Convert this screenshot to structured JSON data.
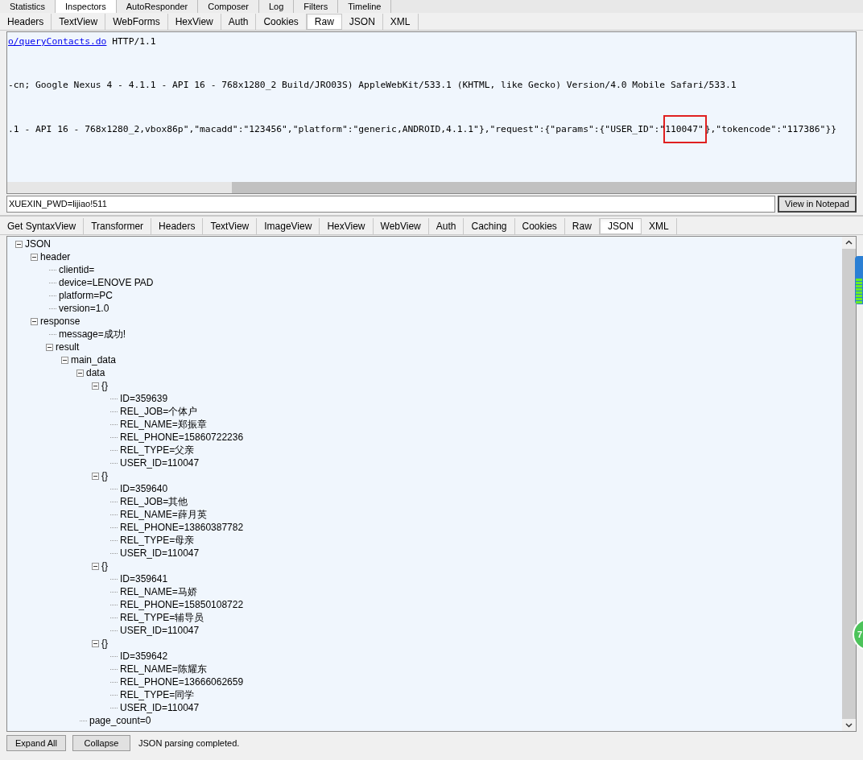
{
  "main_tabs": [
    {
      "label": "Statistics",
      "selected": false
    },
    {
      "label": "Inspectors",
      "selected": true
    },
    {
      "label": "AutoResponder",
      "selected": false
    },
    {
      "label": "Composer",
      "selected": false
    },
    {
      "label": "Log",
      "selected": false
    },
    {
      "label": "Filters",
      "selected": false
    },
    {
      "label": "Timeline",
      "selected": false
    }
  ],
  "request_tabs": [
    {
      "label": "Headers",
      "selected": false
    },
    {
      "label": "TextView",
      "selected": false
    },
    {
      "label": "WebForms",
      "selected": false
    },
    {
      "label": "HexView",
      "selected": false
    },
    {
      "label": "Auth",
      "selected": false
    },
    {
      "label": "Cookies",
      "selected": false
    },
    {
      "label": "Raw",
      "selected": true
    },
    {
      "label": "JSON",
      "selected": false
    },
    {
      "label": "XML",
      "selected": false
    }
  ],
  "raw_lines": [
    [
      {
        "kind": "link",
        "text": "o/queryContacts.do"
      },
      {
        "kind": "plain",
        "text": " HTTP/1.1"
      }
    ],
    [
      {
        "kind": "plain",
        "text": "-cn; Google Nexus 4 - 4.1.1 - API 16 - 768x1280_2 Build/JRO03S) AppleWebKit/533.1 (KHTML, like Gecko) Version/4.0 Mobile Safari/533.1"
      }
    ],
    [
      {
        "kind": "plain",
        "text": ".1 - API 16 - 768x1280_2,vbox86p\",\"macadd\":\"123456\",\"platform\":\"generic,ANDROID,4.1.1\"},\"request\":{\"params\":{\"USER_ID\":\""
      },
      {
        "kind": "boxed",
        "text": "110047\""
      },
      {
        "kind": "plain",
        "text": "},\"tokencode\":\"117386\"}}"
      }
    ]
  ],
  "cookie_field": {
    "value": "XUEXIN_PWD=lijiao!511"
  },
  "notepad_button": "View in Notepad",
  "response_tabs": [
    {
      "label": "Get SyntaxView",
      "selected": false
    },
    {
      "label": "Transformer",
      "selected": false
    },
    {
      "label": "Headers",
      "selected": false
    },
    {
      "label": "TextView",
      "selected": false
    },
    {
      "label": "ImageView",
      "selected": false
    },
    {
      "label": "HexView",
      "selected": false
    },
    {
      "label": "WebView",
      "selected": false
    },
    {
      "label": "Auth",
      "selected": false
    },
    {
      "label": "Caching",
      "selected": false
    },
    {
      "label": "Cookies",
      "selected": false
    },
    {
      "label": "Raw",
      "selected": false
    },
    {
      "label": "JSON",
      "selected": true
    },
    {
      "label": "XML",
      "selected": false
    }
  ],
  "tree": [
    {
      "label": "JSON",
      "expanded": true,
      "children": [
        {
          "label": "header",
          "expanded": true,
          "children": [
            {
              "label": "clientid="
            },
            {
              "label": "device=LENOVE PAD"
            },
            {
              "label": "platform=PC"
            },
            {
              "label": "version=1.0"
            }
          ]
        },
        {
          "label": "response",
          "expanded": true,
          "children": [
            {
              "label": "message=成功!"
            },
            {
              "label": "result",
              "expanded": true,
              "children": [
                {
                  "label": "main_data",
                  "expanded": true,
                  "children": [
                    {
                      "label": "data",
                      "expanded": true,
                      "children": [
                        {
                          "label": "{}",
                          "expanded": true,
                          "children": [
                            {
                              "label": "ID=359639"
                            },
                            {
                              "label": "REL_JOB=个体户"
                            },
                            {
                              "label": "REL_NAME=郑振章"
                            },
                            {
                              "label": "REL_PHONE=15860722236"
                            },
                            {
                              "label": "REL_TYPE=父亲"
                            },
                            {
                              "label": "USER_ID=110047"
                            }
                          ]
                        },
                        {
                          "label": "{}",
                          "expanded": true,
                          "children": [
                            {
                              "label": "ID=359640"
                            },
                            {
                              "label": "REL_JOB=其他"
                            },
                            {
                              "label": "REL_NAME=薛月英"
                            },
                            {
                              "label": "REL_PHONE=13860387782"
                            },
                            {
                              "label": "REL_TYPE=母亲"
                            },
                            {
                              "label": "USER_ID=110047"
                            }
                          ]
                        },
                        {
                          "label": "{}",
                          "expanded": true,
                          "children": [
                            {
                              "label": "ID=359641"
                            },
                            {
                              "label": "REL_NAME=马娇"
                            },
                            {
                              "label": "REL_PHONE=15850108722"
                            },
                            {
                              "label": "REL_TYPE=辅导员"
                            },
                            {
                              "label": "USER_ID=110047"
                            }
                          ]
                        },
                        {
                          "label": "{}",
                          "expanded": true,
                          "children": [
                            {
                              "label": "ID=359642"
                            },
                            {
                              "label": "REL_NAME=陈耀东"
                            },
                            {
                              "label": "REL_PHONE=13666062659"
                            },
                            {
                              "label": "REL_TYPE=同学"
                            },
                            {
                              "label": "USER_ID=110047"
                            }
                          ]
                        }
                      ]
                    },
                    {
                      "label": "page_count=0"
                    }
                  ]
                }
              ]
            }
          ]
        }
      ]
    }
  ],
  "footer_buttons": [
    "Expand All",
    "Collapse"
  ],
  "status": "JSON parsing completed.",
  "floating_badge": "7"
}
